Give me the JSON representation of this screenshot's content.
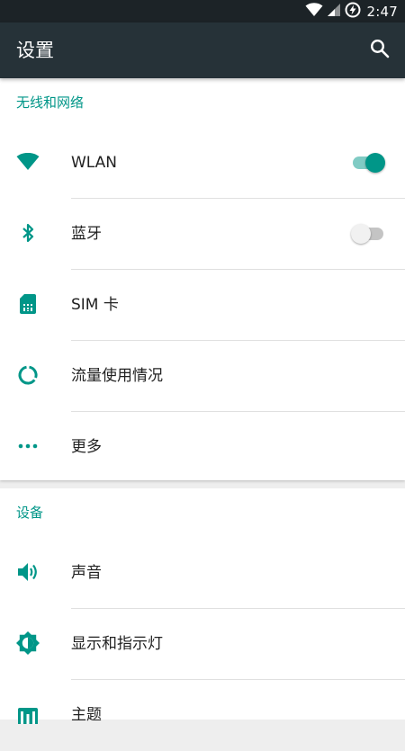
{
  "status_bar": {
    "time": "2:47",
    "icons": [
      "wifi-icon",
      "signal-icon",
      "battery-charging-icon"
    ]
  },
  "app_bar": {
    "title": "设置",
    "search_icon": "search-icon"
  },
  "sections": [
    {
      "header": "无线和网络",
      "items": [
        {
          "label": "WLAN",
          "icon": "wifi-icon",
          "toggle": true
        },
        {
          "label": "蓝牙",
          "icon": "bluetooth-icon",
          "toggle": false
        },
        {
          "label": "SIM 卡",
          "icon": "sim-card-icon"
        },
        {
          "label": "流量使用情况",
          "icon": "data-usage-icon"
        },
        {
          "label": "更多",
          "icon": "more-icon"
        }
      ]
    },
    {
      "header": "设备",
      "items": [
        {
          "label": "声音",
          "icon": "volume-icon"
        },
        {
          "label": "显示和指示灯",
          "icon": "brightness-icon"
        },
        {
          "label": "主题",
          "icon": "theme-icon"
        }
      ]
    }
  ],
  "colors": {
    "accent": "#009688",
    "app_bar": "#263238",
    "status_bar": "#1c2327"
  }
}
